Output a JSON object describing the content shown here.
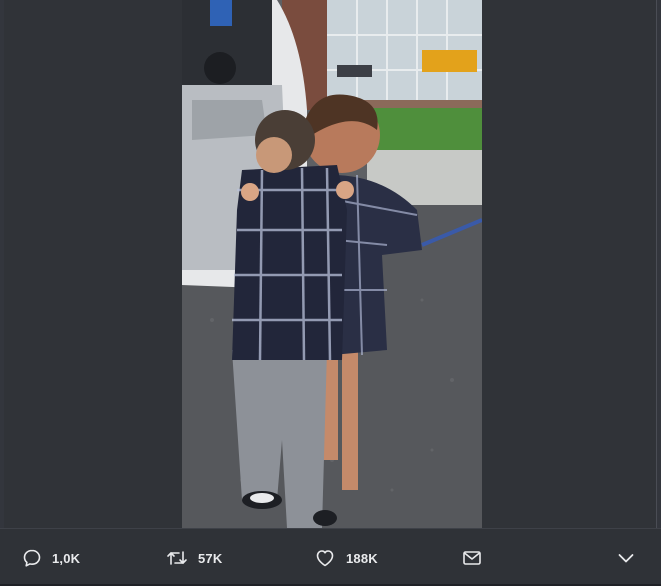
{
  "actions": {
    "reply": {
      "icon": "reply-icon",
      "count": "1,0K"
    },
    "retweet": {
      "icon": "retweet-icon",
      "count": "57K"
    },
    "like": {
      "icon": "heart-icon",
      "count": "188K"
    },
    "message": {
      "icon": "envelope-icon"
    },
    "more": {
      "icon": "chevron-down-icon"
    }
  },
  "colors": {
    "background": "#33363d",
    "action_text": "#e9eaec"
  }
}
